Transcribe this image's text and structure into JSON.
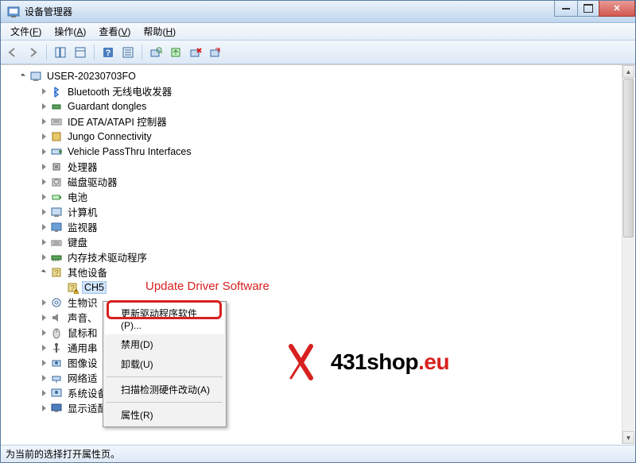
{
  "window": {
    "title": "设备管理器"
  },
  "menubar": [
    {
      "label": "文件",
      "accel": "F"
    },
    {
      "label": "操作",
      "accel": "A"
    },
    {
      "label": "查看",
      "accel": "V"
    },
    {
      "label": "帮助",
      "accel": "H"
    }
  ],
  "tree": {
    "root": "USER-20230703FO",
    "nodes": [
      {
        "label": "Bluetooth 无线电收发器",
        "icon": "bluetooth"
      },
      {
        "label": "Guardant dongles",
        "icon": "dongle"
      },
      {
        "label": "IDE ATA/ATAPI 控制器",
        "icon": "ide"
      },
      {
        "label": "Jungo Connectivity",
        "icon": "jungo"
      },
      {
        "label": "Vehicle PassThru Interfaces",
        "icon": "passthru"
      },
      {
        "label": "处理器",
        "icon": "cpu"
      },
      {
        "label": "磁盘驱动器",
        "icon": "disk"
      },
      {
        "label": "电池",
        "icon": "battery"
      },
      {
        "label": "计算机",
        "icon": "computer"
      },
      {
        "label": "监视器",
        "icon": "monitor"
      },
      {
        "label": "键盘",
        "icon": "keyboard"
      },
      {
        "label": "内存技术驱动程序",
        "icon": "memory"
      },
      {
        "label": "其他设备",
        "icon": "other",
        "open": true,
        "children": [
          {
            "label": "CH5",
            "icon": "unknown",
            "warning": true,
            "selected": true
          }
        ]
      },
      {
        "label": "生物识",
        "icon": "bio"
      },
      {
        "label": "声音、",
        "icon": "sound"
      },
      {
        "label": "鼠标和",
        "icon": "mouse"
      },
      {
        "label": "通用串",
        "icon": "usb"
      },
      {
        "label": "图像设",
        "icon": "image"
      },
      {
        "label": "网络适",
        "icon": "network"
      },
      {
        "label": "系统设备",
        "icon": "system"
      },
      {
        "label": "显示适配器",
        "icon": "display"
      }
    ]
  },
  "contextmenu": {
    "items": [
      {
        "label": "更新驱动程序软件(P)...",
        "highlight": true
      },
      {
        "label": "禁用(D)"
      },
      {
        "label": "卸载(U)"
      },
      {
        "sep": true
      },
      {
        "label": "扫描检测硬件改动(A)"
      },
      {
        "sep": true
      },
      {
        "label": "属性(R)"
      }
    ]
  },
  "annotation": {
    "red_label": "Update Driver Software"
  },
  "logo": {
    "part1": "431shop",
    "part2": ".eu"
  },
  "statusbar": "为当前的选择打开属性页。"
}
